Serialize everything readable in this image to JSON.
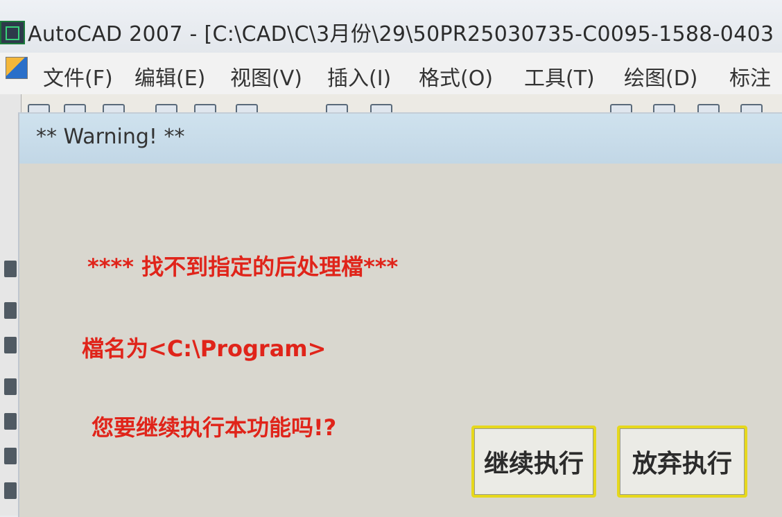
{
  "window": {
    "title": "AutoCAD 2007 - [C:\\CAD\\C\\3月份\\29\\50PR25030735-C0095-1588-0403"
  },
  "menu": {
    "items": [
      "文件(F)",
      "编辑(E)",
      "视图(V)",
      "插入(I)",
      "格式(O)",
      "工具(T)",
      "绘图(D)",
      "标注"
    ]
  },
  "dialog": {
    "title": "** Warning! **",
    "message_line1": "**** 找不到指定的后处理檔***",
    "message_line2": "檔名为<C:\\Program>",
    "message_line3": "您要继续执行本功能吗!?",
    "continue_label": "继续执行",
    "abort_label": "放弃执行"
  },
  "colors": {
    "message": "#e0241a",
    "button_focus_border": "#e6d81d",
    "dialog_bg": "#d9d7cf"
  }
}
